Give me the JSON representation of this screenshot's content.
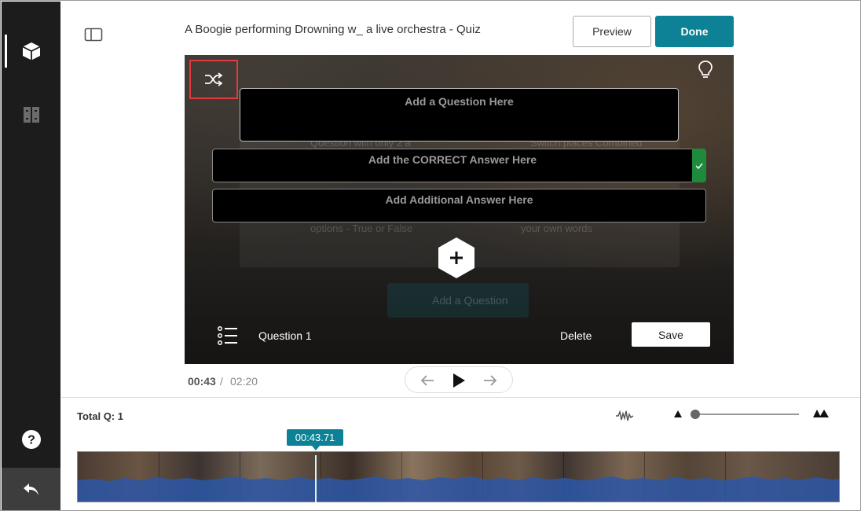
{
  "header": {
    "title": "A Boogie performing Drowning w_ a live orchestra - Quiz",
    "preview_label": "Preview",
    "done_label": "Done"
  },
  "sidebar": {
    "items": [
      {
        "name": "quiz-editor",
        "icon": "cube-icon",
        "active": true
      },
      {
        "name": "chapters",
        "icon": "book-icon",
        "active": false
      }
    ],
    "help_icon": "help-icon",
    "back_icon": "undo-icon"
  },
  "editor": {
    "question_placeholder": "Add a Question Here",
    "correct_answer_placeholder": "Add the CORRECT Answer Here",
    "additional_answer_placeholder": "Add Additional Answer Here",
    "question_label": "Question 1",
    "delete_label": "Delete",
    "save_label": "Save"
  },
  "background_ghost": {
    "text1": "Question with only 2 a",
    "text2": "Switch places Combined",
    "text3": "options - True or False",
    "text4": "your own words",
    "button": "Add a Question"
  },
  "player": {
    "current_time": "00:43",
    "separator": "/",
    "total_time": "02:20"
  },
  "timeline": {
    "total_questions": "Total Q: 1",
    "playhead_time": "00:43.71",
    "zoom_level": 0.0
  },
  "colors": {
    "accent": "#0d8296",
    "correct": "#1e8a3c",
    "highlight": "#e0393e",
    "sidebar": "#1c1c1c"
  }
}
